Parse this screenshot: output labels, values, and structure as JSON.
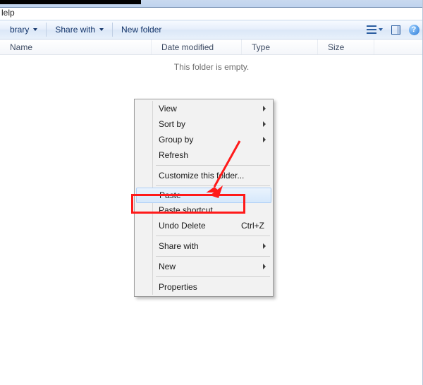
{
  "menubar": {
    "help": "lelp"
  },
  "toolbar": {
    "library": "brary",
    "share": "Share with",
    "newfolder": "New folder"
  },
  "columns": {
    "name": "Name",
    "date": "Date modified",
    "type": "Type",
    "size": "Size"
  },
  "empty_message": "This folder is empty.",
  "context_menu": {
    "view": "View",
    "sort": "Sort by",
    "group": "Group by",
    "refresh": "Refresh",
    "customize": "Customize this folder...",
    "paste": "Paste",
    "paste_shortcut": "Paste shortcut",
    "undo": "Undo Delete",
    "undo_key": "Ctrl+Z",
    "share": "Share with",
    "new": "New",
    "properties": "Properties"
  }
}
